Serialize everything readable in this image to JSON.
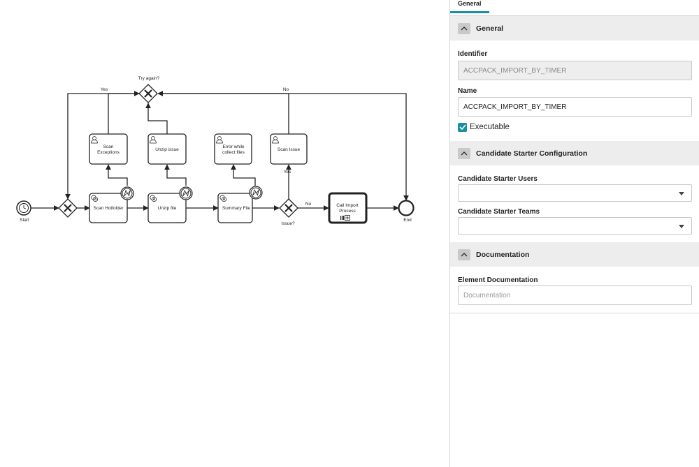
{
  "diagram": {
    "nodes": {
      "start": "Start",
      "end": "End",
      "gateway_try_again": "Try again?",
      "gateway_issue": "Issue?",
      "scan_hotfolder": "Scan Hotfolder",
      "unzip_file": "Unzip file",
      "summary_file": "Summary File",
      "call_import_process": [
        "Call Import",
        "Process"
      ],
      "scan_exceptions": [
        "Scan",
        "Exceptions"
      ],
      "unzip_issue": "Unzip issue",
      "error_collect": [
        "Error while",
        "collect files"
      ],
      "scan_issue": "Scan Issue"
    },
    "flow_labels": {
      "yes_top": "Yes",
      "no_top": "No",
      "yes_issue": "Yes",
      "no_issue": "No"
    },
    "colors": {
      "stroke": "#222222"
    }
  },
  "panel": {
    "tab_general": "General",
    "general": {
      "title": "General",
      "identifier_label": "Identifier",
      "identifier_value": "ACCPACK_IMPORT_BY_TIMER",
      "name_label": "Name",
      "name_value": "ACCPACK_IMPORT_BY_TIMER",
      "executable_label": "Executable",
      "executable_checked": true
    },
    "candidate": {
      "title": "Candidate Starter Configuration",
      "users_label": "Candidate Starter Users",
      "teams_label": "Candidate Starter Teams"
    },
    "documentation": {
      "title": "Documentation",
      "element_label": "Element Documentation",
      "placeholder": "Documentation"
    },
    "colors": {
      "accent": "#1a8fa3",
      "section_bg": "#ededed"
    }
  }
}
